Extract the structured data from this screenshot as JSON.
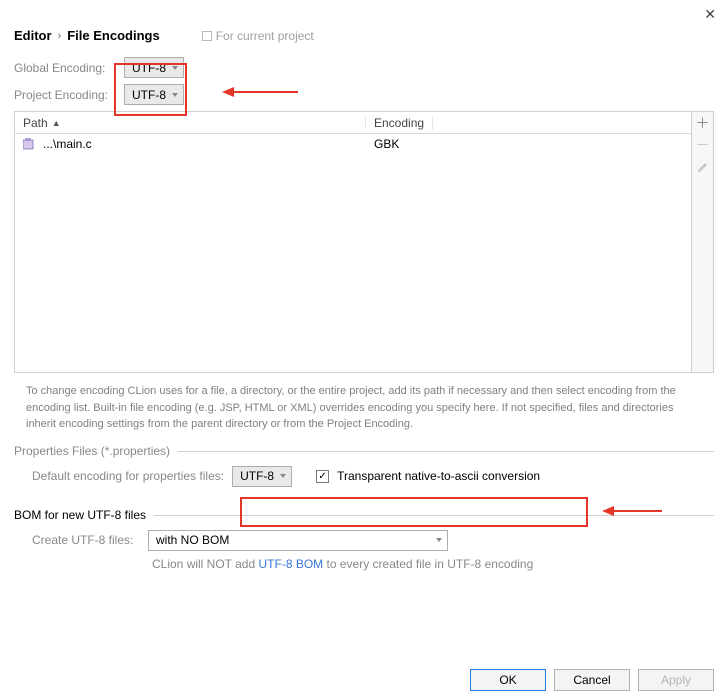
{
  "header": {
    "crumb1": "Editor",
    "crumb2": "File Encodings",
    "scope": "For current project"
  },
  "encoding": {
    "global_label": "Global Encoding:",
    "global_value": "UTF-8",
    "project_label": "Project Encoding:",
    "project_value": "UTF-8"
  },
  "table": {
    "col_path": "Path",
    "col_encoding": "Encoding",
    "rows": [
      {
        "path": "...\\main.c",
        "encoding": "GBK"
      }
    ]
  },
  "help": "To change encoding CLion uses for a file, a directory, or the entire project, add its path if necessary and then select encoding from the encoding list. Built-in file encoding (e.g. JSP, HTML or XML) overrides encoding you specify here. If not specified, files and directories inherit encoding settings from the parent directory or from the Project Encoding.",
  "properties": {
    "legend": "Properties Files (*.properties)",
    "default_label": "Default encoding for properties files:",
    "default_value": "UTF-8",
    "transparent_label": "Transparent native-to-ascii conversion",
    "transparent_checked": true
  },
  "bom": {
    "legend": "BOM for new UTF-8 files",
    "create_label": "Create UTF-8 files:",
    "create_value": "with NO BOM",
    "hint_pre": "CLion will NOT add ",
    "hint_link": "UTF-8 BOM",
    "hint_post": " to every created file in UTF-8 encoding"
  },
  "buttons": {
    "ok": "OK",
    "cancel": "Cancel",
    "apply": "Apply"
  }
}
